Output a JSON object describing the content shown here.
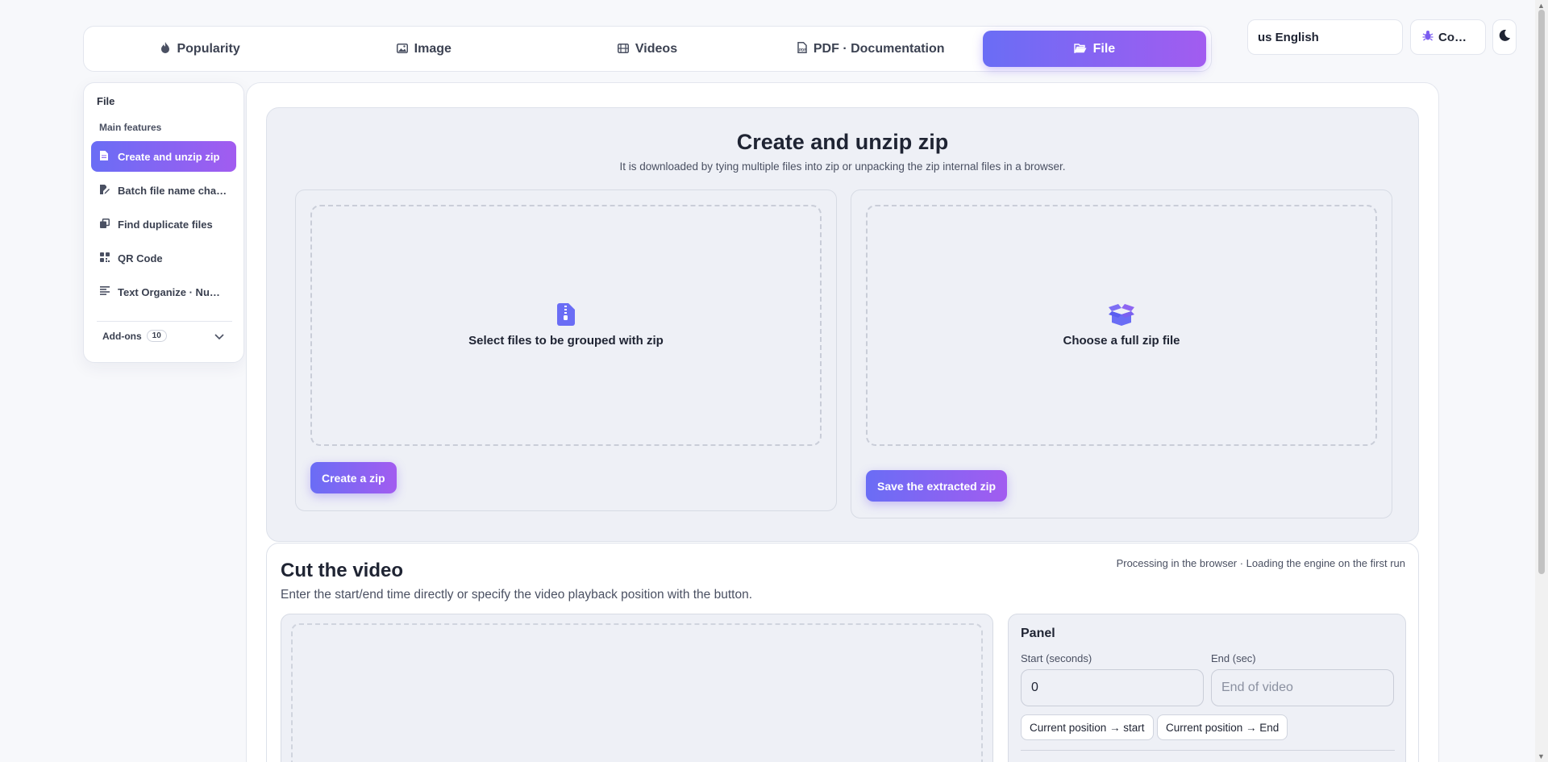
{
  "top_tabs": [
    {
      "label": "Popularity",
      "icon": "flame-icon"
    },
    {
      "label": "Image",
      "icon": "image-icon"
    },
    {
      "label": "Videos",
      "icon": "film-icon"
    },
    {
      "label": "PDF · Documentation",
      "icon": "pdf-icon"
    },
    {
      "label": "File",
      "icon": "folder-open-icon",
      "active": true
    }
  ],
  "header": {
    "language": "us English",
    "contrib_label": "Co…",
    "theme_icon": "moon-icon"
  },
  "sidebar": {
    "title": "File",
    "section": "Main features",
    "items": [
      {
        "label": "Create and unzip zip",
        "icon": "file-icon",
        "active": true
      },
      {
        "label": "Batch file name cha…",
        "icon": "rename-icon"
      },
      {
        "label": "Find duplicate files",
        "icon": "copy-icon"
      },
      {
        "label": "QR Code",
        "icon": "qr-icon"
      },
      {
        "label": "Text Organize · Num…",
        "icon": "align-left-icon"
      }
    ],
    "addons_label": "Add-ons",
    "addons_count": "10"
  },
  "zip": {
    "title": "Create and unzip zip",
    "description": "It is downloaded by tying multiple files into zip or unpacking the zip internal files in a browser.",
    "create": {
      "drop_label": "Select files to be grouped with zip",
      "button": "Create a zip"
    },
    "extract": {
      "drop_label": "Choose a full zip file",
      "button": "Save the extracted zip"
    }
  },
  "video": {
    "title": "Cut the video",
    "description": "Enter the start/end time directly or specify the video playback position with the button.",
    "note": "Processing in the browser · Loading the engine on the first run",
    "panel": {
      "title": "Panel",
      "start_label": "Start (seconds)",
      "start_value": "0",
      "end_label": "End (sec)",
      "end_placeholder": "End of video",
      "set_start_button": "Current position → start",
      "set_end_button": "Current position → End"
    }
  },
  "colors": {
    "accent_start": "#6a6df5",
    "accent_end": "#a25cf0"
  }
}
